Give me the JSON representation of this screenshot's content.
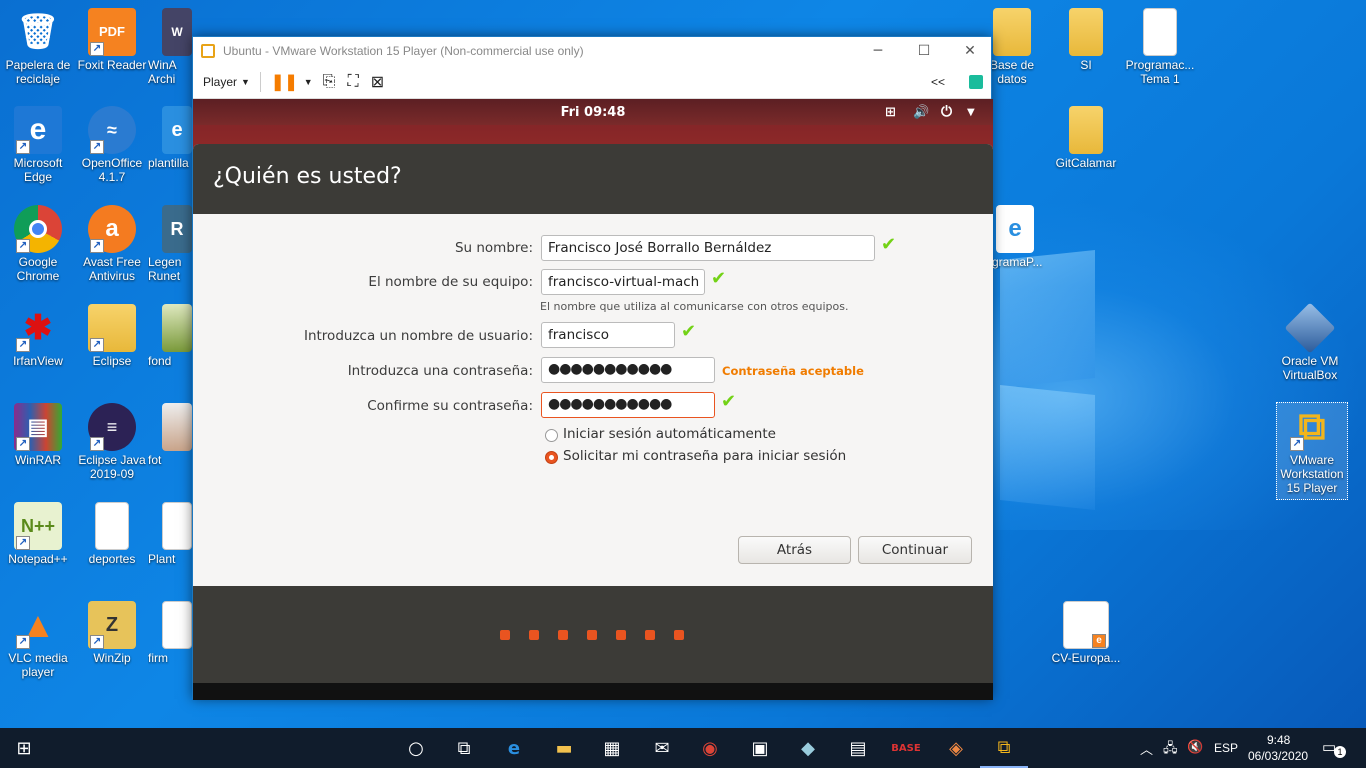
{
  "desktop": {
    "icons": [
      {
        "name": "recycle-bin-icon",
        "label": "Papelera de reciclaje",
        "x": 0,
        "y": 0
      },
      {
        "name": "foxit-reader-icon",
        "label": "Foxit Reader"
      },
      {
        "name": "winarchiver-icon",
        "label": "WinA Archi"
      },
      {
        "name": "microsoft-edge-icon",
        "label": "Microsoft Edge"
      },
      {
        "name": "openoffice-icon",
        "label": "OpenOffice 4.1.7"
      },
      {
        "name": "plantilla-icon",
        "label": "plantilla"
      },
      {
        "name": "google-chrome-icon",
        "label": "Google Chrome"
      },
      {
        "name": "avast-icon",
        "label": "Avast Free Antivirus"
      },
      {
        "name": "legends-runeterra-icon",
        "label": "Legen Runet"
      },
      {
        "name": "irfanview-icon",
        "label": "IrfanView"
      },
      {
        "name": "eclipse-icon",
        "label": "Eclipse"
      },
      {
        "name": "fondo-icon",
        "label": "fond"
      },
      {
        "name": "winrar-icon",
        "label": "WinRAR"
      },
      {
        "name": "eclipse-java-icon",
        "label": "Eclipse Java 2019-09"
      },
      {
        "name": "foto-icon",
        "label": "fot"
      },
      {
        "name": "notepadpp-icon",
        "label": "Notepad++"
      },
      {
        "name": "deportes-icon",
        "label": "deportes"
      },
      {
        "name": "plantilla2-icon",
        "label": "Plant"
      },
      {
        "name": "vlc-icon",
        "label": "VLC media player"
      },
      {
        "name": "winzip-icon",
        "label": "WinZip"
      },
      {
        "name": "firma-icon",
        "label": "firm"
      },
      {
        "name": "base-datos-icon",
        "label": "Base de datos"
      },
      {
        "name": "si-folder-icon",
        "label": "SI"
      },
      {
        "name": "programacion-icon",
        "label": "Programac... Tema 1"
      },
      {
        "name": "gitcalamar-icon",
        "label": "GitCalamar"
      },
      {
        "name": "programap-icon",
        "label": "gramaP..."
      },
      {
        "name": "oracle-vm-icon",
        "label": "Oracle VM VirtualBox"
      },
      {
        "name": "vmware-icon",
        "label": "VMware Workstation 15 Player"
      },
      {
        "name": "cv-europass-icon",
        "label": "CV-Europa..."
      }
    ]
  },
  "vmware": {
    "title": "Ubuntu - VMware Workstation 15 Player (Non-commercial use only)",
    "player_menu": "Player",
    "collapse": "<<"
  },
  "ubuntu": {
    "clock": "Fri 09:48",
    "heading": "¿Quién es usted?",
    "fields": {
      "name_label": "Su nombre:",
      "name_value": "Francisco José Borrallo Bernáldez",
      "computer_label": "El nombre de su equipo:",
      "computer_value": "francisco-virtual-mach",
      "computer_hint": "El nombre que utiliza al comunicarse con otros equipos.",
      "user_label": "Introduzca un nombre de usuario:",
      "user_value": "francisco",
      "pass_label": "Introduzca una contraseña:",
      "pass_value": "●●●●●●●●●●●",
      "pass_strength": "Contraseña aceptable",
      "confirm_label": "Confirme su contraseña:",
      "confirm_value": "●●●●●●●●●●●"
    },
    "options": {
      "auto_login": "Iniciar sesión automáticamente",
      "require_password": "Solicitar mi contraseña para iniciar sesión",
      "selected": "require_password"
    },
    "buttons": {
      "back": "Atrás",
      "continue": "Continuar"
    },
    "progress_steps": 7,
    "accent": "#e95420"
  },
  "taskbar": {
    "lang": "ESP",
    "time": "9:48",
    "date": "06/03/2020",
    "notifications": "1"
  }
}
